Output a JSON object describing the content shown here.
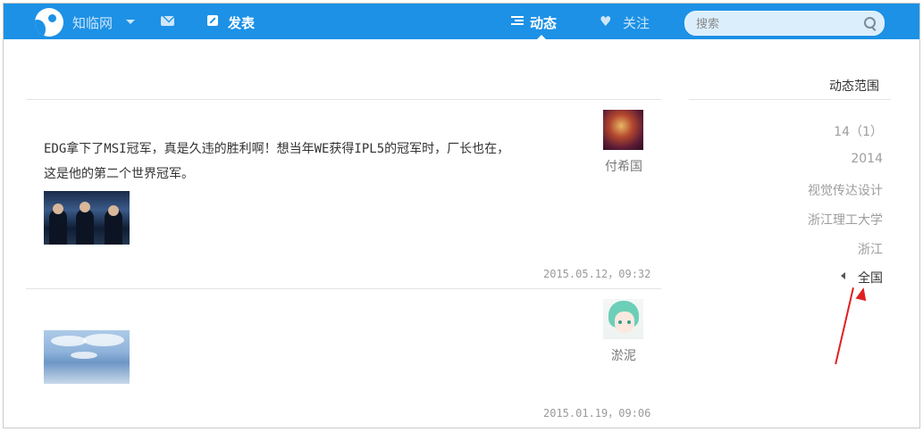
{
  "header": {
    "brand": "知临网",
    "post_label": "发表",
    "dynamic_label": "动态",
    "follow_label": "关注",
    "search_placeholder": "搜索"
  },
  "feed": [
    {
      "text_line1": "EDG拿下了MSI冠军，真是久违的胜利啊！想当年WE获得IPL5的冠军时，厂长也在，",
      "text_line2": "这是他的第二个世界冠军。",
      "author": "付希国",
      "time": "2015.05.12，09:32"
    },
    {
      "author": "淤泥",
      "time": "2015.01.19，09:06"
    }
  ],
  "sidebar": {
    "title": "动态范围",
    "items": [
      "14（1）",
      "2014",
      "视觉传达设计",
      "浙江理工大学",
      "浙江",
      "全国"
    ]
  },
  "colors": {
    "topbar": "#1c91e6",
    "annotation_arrow": "#e02020"
  }
}
